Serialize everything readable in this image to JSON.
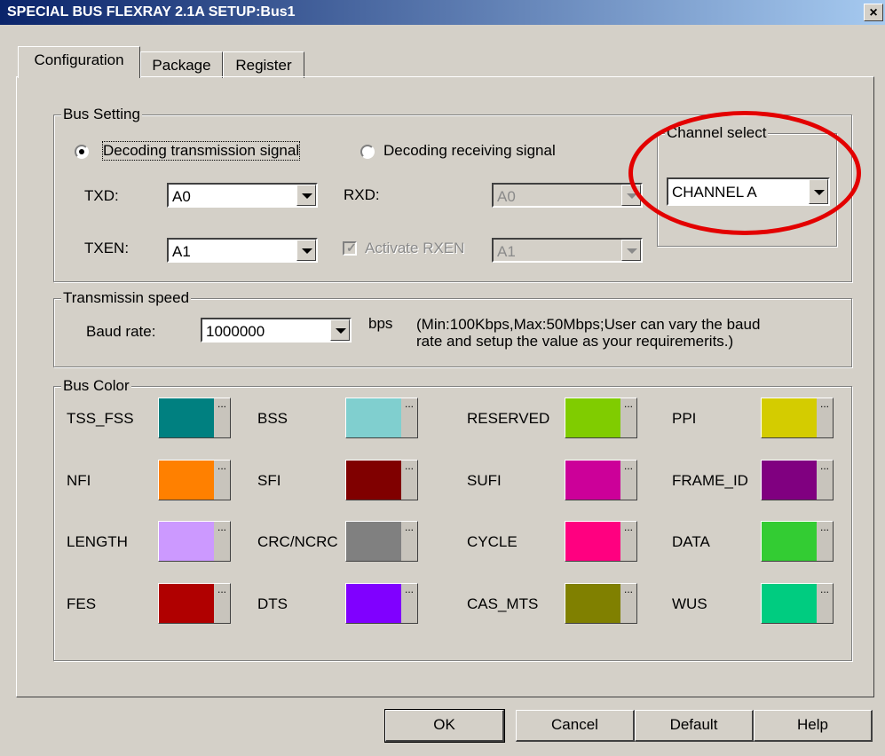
{
  "window": {
    "title": "SPECIAL BUS FLEXRAY 2.1A SETUP:Bus1",
    "close": "×"
  },
  "tabs": [
    {
      "label": "Configuration"
    },
    {
      "label": "Package"
    },
    {
      "label": "Register"
    }
  ],
  "bus_setting": {
    "title": "Bus Setting",
    "radio_tx": "Decoding transmission signal",
    "radio_rx": "Decoding receiving signal",
    "txd_label": "TXD:",
    "txd_value": "A0",
    "txen_label": "TXEN:",
    "txen_value": "A1",
    "rxd_label": "RXD:",
    "rxd_value": "A0",
    "activate_rxen": "Activate RXEN",
    "rxen_value": "A1",
    "channel": {
      "title": "Channel select",
      "value": "CHANNEL A"
    }
  },
  "speed": {
    "title": "Transmissin speed",
    "baud_label": "Baud rate:",
    "baud_value": "1000000",
    "unit": "bps",
    "note_line1": "(Min:100Kbps,Max:50Mbps;User can vary the baud",
    "note_line2": "rate and setup the value as your requiremerits.)"
  },
  "bus_color": {
    "title": "Bus Color",
    "items": [
      {
        "label": "TSS_FSS",
        "color": "#008080"
      },
      {
        "label": "BSS",
        "color": "#80cfcf"
      },
      {
        "label": "RESERVED",
        "color": "#80cc00"
      },
      {
        "label": "PPI",
        "color": "#d4cc00"
      },
      {
        "label": "NFI",
        "color": "#ff8000"
      },
      {
        "label": "SFI",
        "color": "#800000"
      },
      {
        "label": "SUFI",
        "color": "#cc0099"
      },
      {
        "label": "FRAME_ID",
        "color": "#800080"
      },
      {
        "label": "LENGTH",
        "color": "#cc99ff"
      },
      {
        "label": "CRC/NCRC",
        "color": "#808080"
      },
      {
        "label": "CYCLE",
        "color": "#ff0080"
      },
      {
        "label": "DATA",
        "color": "#33cc33"
      },
      {
        "label": "FES",
        "color": "#b00000"
      },
      {
        "label": "DTS",
        "color": "#8000ff"
      },
      {
        "label": "CAS_MTS",
        "color": "#808000"
      },
      {
        "label": "WUS",
        "color": "#00cc80"
      }
    ],
    "more": "..."
  },
  "buttons": {
    "ok": "OK",
    "cancel": "Cancel",
    "default": "Default",
    "help": "Help"
  }
}
